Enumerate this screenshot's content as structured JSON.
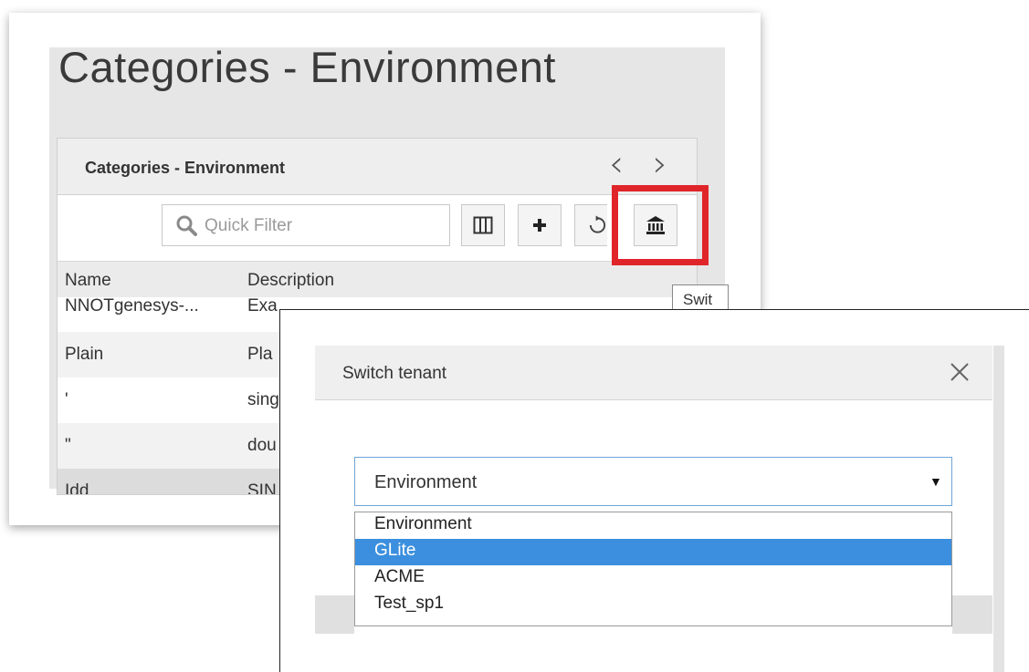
{
  "page": {
    "title": "Categories - Environment"
  },
  "panel": {
    "title": "Categories - Environment",
    "prev_icon": "chevron-left-icon",
    "next_icon": "chevron-right-icon"
  },
  "toolbar": {
    "filter_placeholder": "Quick Filter",
    "columns_icon": "columns-icon",
    "add_icon": "plus-icon",
    "refresh_icon": "refresh-icon",
    "tenant_icon": "bank-icon"
  },
  "grid": {
    "columns": [
      "Name",
      "Description"
    ],
    "rows": [
      {
        "name": "NNOTgenesys-...",
        "description": "Exa"
      },
      {
        "name": "Plain",
        "description": "Pla"
      },
      {
        "name": "'",
        "description": "sing"
      },
      {
        "name": "\"",
        "description": "dou"
      },
      {
        "name": "Idd",
        "description": "SIN"
      }
    ]
  },
  "tooltip": {
    "text": "Swit"
  },
  "dialog": {
    "title": "Switch tenant",
    "close_icon": "close-icon",
    "selected": "Environment",
    "options": [
      "Environment",
      "GLite",
      "ACME",
      "Test_sp1"
    ],
    "highlighted_option": "GLite"
  },
  "colors": {
    "highlight_border": "#e0252a",
    "selected_option_bg": "#3b8fde",
    "select_border": "#6fa5d6"
  }
}
